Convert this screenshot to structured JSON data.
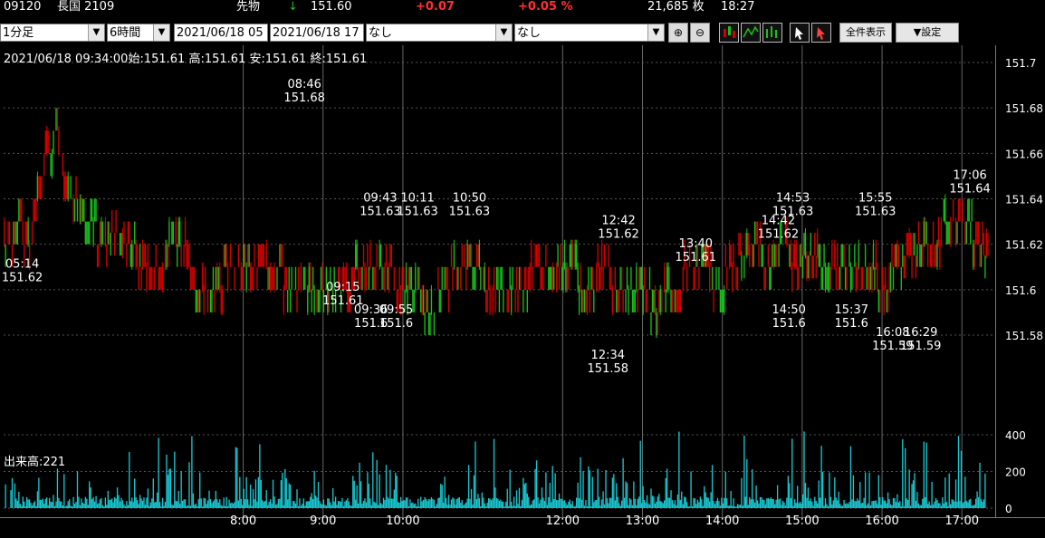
{
  "header": {
    "code": "09120",
    "name": "長国 2109",
    "category": "先物",
    "direction_arrow": "↓",
    "price": "151.60",
    "change": "+0.07",
    "change_pct": "+0.05 %",
    "volume": "21,685 枚",
    "time": "18:27"
  },
  "toolbar": {
    "interval": "1分足",
    "span": "6時間",
    "date_from": "2021/06/18 05",
    "date_to": "2021/06/18 17",
    "indicator1": "なし",
    "indicator2": "なし",
    "zoom_in": "⊕",
    "zoom_out": "⊖",
    "show_all_label": "全件表示",
    "settings_label": "▼設定"
  },
  "colors": {
    "up": "#19c219",
    "down": "#d40000",
    "volume": "#19c8d2",
    "grid": "#3a3a3a"
  },
  "chart_data": {
    "type": "candlestick",
    "info_line": "2021/06/18 09:34:00始:151.61 高:151.61 安:151.61 終:151.61",
    "volume_label": "出来高:221",
    "y_ticks": [
      "151.7",
      "151.68",
      "151.66",
      "151.64",
      "151.62",
      "151.6",
      "151.58"
    ],
    "ylim": [
      151.569,
      151.702
    ],
    "volume_ticks": [
      "400",
      "200",
      "0"
    ],
    "volume_ylim": [
      0,
      400
    ],
    "x_ticks": [
      {
        "t": 180,
        "label": "8:00"
      },
      {
        "t": 240,
        "label": "9:00"
      },
      {
        "t": 300,
        "label": "10:00"
      },
      {
        "t": 420,
        "label": "12:00"
      },
      {
        "t": 480,
        "label": "13:00"
      },
      {
        "t": 540,
        "label": "14:00"
      },
      {
        "t": 600,
        "label": "15:00"
      },
      {
        "t": 660,
        "label": "16:00"
      },
      {
        "t": 720,
        "label": "17:00"
      }
    ],
    "annotations": [
      {
        "time": "05:14",
        "price": "151.62",
        "t": 14,
        "pos": "below"
      },
      {
        "time": "08:46",
        "price": "151.68",
        "t": 226,
        "pos": "above"
      },
      {
        "time": "09:15",
        "price": "151.61",
        "t": 255,
        "pos": "below"
      },
      {
        "time": "09:36",
        "price": "151.6",
        "t": 276,
        "pos": "below"
      },
      {
        "time": "09:43",
        "price": "151.63",
        "t": 283,
        "pos": "above"
      },
      {
        "time": "09:55",
        "price": "151.6",
        "t": 295,
        "pos": "below"
      },
      {
        "time": "10:11",
        "price": "151.63",
        "t": 311,
        "pos": "above"
      },
      {
        "time": "10:50",
        "price": "151.63",
        "t": 350,
        "pos": "above"
      },
      {
        "time": "12:34",
        "price": "151.58",
        "t": 454,
        "pos": "below"
      },
      {
        "time": "12:42",
        "price": "151.62",
        "t": 462,
        "pos": "above"
      },
      {
        "time": "13:40",
        "price": "151.61",
        "t": 520,
        "pos": "above"
      },
      {
        "time": "14:42",
        "price": "151.62",
        "t": 582,
        "pos": "above"
      },
      {
        "time": "14:50",
        "price": "151.6",
        "t": 590,
        "pos": "below"
      },
      {
        "time": "14:53",
        "price": "151.63",
        "t": 593,
        "pos": "above"
      },
      {
        "time": "15:37",
        "price": "151.6",
        "t": 637,
        "pos": "below"
      },
      {
        "time": "15:55",
        "price": "151.63",
        "t": 655,
        "pos": "above"
      },
      {
        "time": "16:08",
        "price": "151.59",
        "t": 668,
        "pos": "below"
      },
      {
        "time": "16:29",
        "price": "151.59",
        "t": 689,
        "pos": "below"
      },
      {
        "time": "17:06",
        "price": "151.64",
        "t": 726,
        "pos": "above"
      }
    ],
    "segments": [
      {
        "t0": 0,
        "t1": 8,
        "p": 151.62,
        "c": "d"
      },
      {
        "t0": 8,
        "t1": 14,
        "p": 151.63,
        "c": "m"
      },
      {
        "t0": 14,
        "t1": 22,
        "p": 151.62,
        "c": "m"
      },
      {
        "t0": 22,
        "t1": 30,
        "p": 151.64,
        "c": "d"
      },
      {
        "t0": 30,
        "t1": 38,
        "p": 151.66,
        "c": "m"
      },
      {
        "t0": 38,
        "t1": 44,
        "p": 151.67,
        "c": "d"
      },
      {
        "t0": 44,
        "t1": 52,
        "p": 151.65,
        "c": "m"
      },
      {
        "t0": 52,
        "t1": 60,
        "p": 151.64,
        "c": "m"
      },
      {
        "t0": 60,
        "t1": 70,
        "p": 151.63,
        "c": "u"
      },
      {
        "t0": 70,
        "t1": 80,
        "p": 151.62,
        "c": "d"
      },
      {
        "t0": 80,
        "t1": 90,
        "p": 151.625,
        "c": "m"
      },
      {
        "t0": 90,
        "t1": 100,
        "p": 151.62,
        "c": "m"
      },
      {
        "t0": 100,
        "t1": 110,
        "p": 151.61,
        "c": "d"
      },
      {
        "t0": 110,
        "t1": 120,
        "p": 151.61,
        "c": "d"
      },
      {
        "t0": 120,
        "t1": 128,
        "p": 151.62,
        "c": "m"
      },
      {
        "t0": 128,
        "t1": 140,
        "p": 151.62,
        "c": "m"
      },
      {
        "t0": 140,
        "t1": 150,
        "p": 151.6,
        "c": "m"
      },
      {
        "t0": 150,
        "t1": 165,
        "p": 151.6,
        "c": "m"
      },
      {
        "t0": 165,
        "t1": 172,
        "p": 151.61,
        "c": "d"
      },
      {
        "t0": 172,
        "t1": 185,
        "p": 151.61,
        "c": "m"
      },
      {
        "t0": 185,
        "t1": 200,
        "p": 151.61,
        "c": "d"
      },
      {
        "t0": 200,
        "t1": 210,
        "p": 151.61,
        "c": "m"
      },
      {
        "t0": 210,
        "t1": 222,
        "p": 151.6,
        "c": "m"
      },
      {
        "t0": 222,
        "t1": 240,
        "p": 151.6,
        "c": "u"
      },
      {
        "t0": 240,
        "t1": 252,
        "p": 151.6,
        "c": "m"
      },
      {
        "t0": 252,
        "t1": 262,
        "p": 151.6,
        "c": "d"
      },
      {
        "t0": 262,
        "t1": 272,
        "p": 151.61,
        "c": "m"
      },
      {
        "t0": 272,
        "t1": 282,
        "p": 151.61,
        "c": "d"
      },
      {
        "t0": 282,
        "t1": 292,
        "p": 151.61,
        "c": "m"
      },
      {
        "t0": 292,
        "t1": 302,
        "p": 151.6,
        "c": "d"
      },
      {
        "t0": 302,
        "t1": 314,
        "p": 151.6,
        "c": "m"
      },
      {
        "t0": 314,
        "t1": 326,
        "p": 151.59,
        "c": "u"
      },
      {
        "t0": 326,
        "t1": 336,
        "p": 151.6,
        "c": "m"
      },
      {
        "t0": 336,
        "t1": 346,
        "p": 151.61,
        "c": "d"
      },
      {
        "t0": 346,
        "t1": 360,
        "p": 151.61,
        "c": "m"
      },
      {
        "t0": 360,
        "t1": 372,
        "p": 151.6,
        "c": "m"
      },
      {
        "t0": 372,
        "t1": 384,
        "p": 151.6,
        "c": "u"
      },
      {
        "t0": 384,
        "t1": 396,
        "p": 151.6,
        "c": "m"
      },
      {
        "t0": 396,
        "t1": 408,
        "p": 151.61,
        "c": "d"
      },
      {
        "t0": 408,
        "t1": 420,
        "p": 151.61,
        "c": "m"
      },
      {
        "t0": 420,
        "t1": 432,
        "p": 151.61,
        "c": "m"
      },
      {
        "t0": 432,
        "t1": 444,
        "p": 151.6,
        "c": "m"
      },
      {
        "t0": 444,
        "t1": 456,
        "p": 151.61,
        "c": "d"
      },
      {
        "t0": 456,
        "t1": 466,
        "p": 151.6,
        "c": "m"
      },
      {
        "t0": 466,
        "t1": 476,
        "p": 151.6,
        "c": "u"
      },
      {
        "t0": 476,
        "t1": 486,
        "p": 151.6,
        "c": "m"
      },
      {
        "t0": 486,
        "t1": 496,
        "p": 151.59,
        "c": "u"
      },
      {
        "t0": 496,
        "t1": 510,
        "p": 151.6,
        "c": "m"
      },
      {
        "t0": 510,
        "t1": 520,
        "p": 151.61,
        "c": "d"
      },
      {
        "t0": 520,
        "t1": 532,
        "p": 151.61,
        "c": "m"
      },
      {
        "t0": 532,
        "t1": 542,
        "p": 151.6,
        "c": "u"
      },
      {
        "t0": 542,
        "t1": 552,
        "p": 151.61,
        "c": "d"
      },
      {
        "t0": 552,
        "t1": 560,
        "p": 151.615,
        "c": "m"
      },
      {
        "t0": 560,
        "t1": 570,
        "p": 151.62,
        "c": "m"
      },
      {
        "t0": 570,
        "t1": 580,
        "p": 151.61,
        "c": "m"
      },
      {
        "t0": 580,
        "t1": 590,
        "p": 151.62,
        "c": "m"
      },
      {
        "t0": 590,
        "t1": 600,
        "p": 151.61,
        "c": "d"
      },
      {
        "t0": 600,
        "t1": 612,
        "p": 151.615,
        "c": "m"
      },
      {
        "t0": 612,
        "t1": 622,
        "p": 151.61,
        "c": "u"
      },
      {
        "t0": 622,
        "t1": 634,
        "p": 151.61,
        "c": "m"
      },
      {
        "t0": 634,
        "t1": 646,
        "p": 151.61,
        "c": "u"
      },
      {
        "t0": 646,
        "t1": 656,
        "p": 151.61,
        "c": "m"
      },
      {
        "t0": 656,
        "t1": 666,
        "p": 151.6,
        "c": "d"
      },
      {
        "t0": 666,
        "t1": 676,
        "p": 151.61,
        "c": "m"
      },
      {
        "t0": 676,
        "t1": 686,
        "p": 151.615,
        "c": "m"
      },
      {
        "t0": 686,
        "t1": 696,
        "p": 151.62,
        "c": "m"
      },
      {
        "t0": 696,
        "t1": 706,
        "p": 151.62,
        "c": "d"
      },
      {
        "t0": 706,
        "t1": 712,
        "p": 151.63,
        "c": "m"
      },
      {
        "t0": 712,
        "t1": 720,
        "p": 151.63,
        "c": "d"
      },
      {
        "t0": 720,
        "t1": 728,
        "p": 151.63,
        "c": "u"
      },
      {
        "t0": 728,
        "t1": 736,
        "p": 151.62,
        "c": "d"
      },
      {
        "t0": 736,
        "t1": 740,
        "p": 151.615,
        "c": "d"
      }
    ]
  }
}
